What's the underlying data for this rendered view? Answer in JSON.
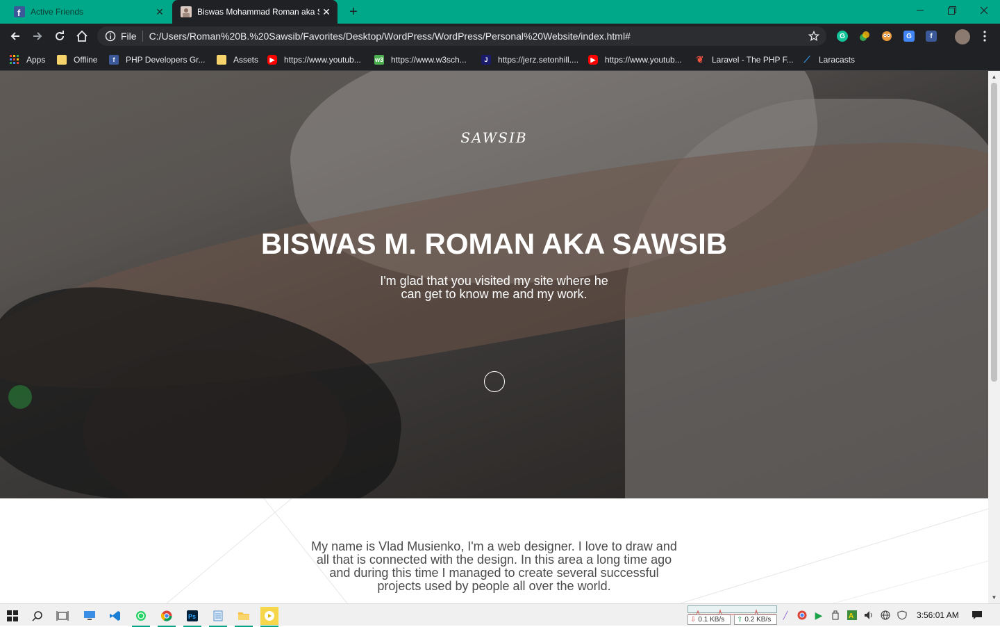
{
  "tabs": [
    {
      "title": "Active Friends",
      "state": "inactive"
    },
    {
      "title": "Biswas Mohammad Roman aka Sawsib",
      "state": "active"
    }
  ],
  "toolbar": {
    "scheme": "File",
    "url": "C:/Users/Roman%20B.%20Sawsib/Favorites/Desktop/WordPress/WordPress/Personal%20Website/index.html#"
  },
  "bookmarks": [
    {
      "label": "Apps",
      "icon": "apps-grid-icon"
    },
    {
      "label": "Offline",
      "icon": "folder-icon"
    },
    {
      "label": "PHP Developers Gr...",
      "icon": "facebook-icon"
    },
    {
      "label": "Assets",
      "icon": "folder-icon"
    },
    {
      "label": "https://www.youtub...",
      "icon": "youtube-icon"
    },
    {
      "label": "https://www.w3sch...",
      "icon": "w3schools-icon"
    },
    {
      "label": "https://jerz.setonhill....",
      "icon": "jerz-icon"
    },
    {
      "label": "https://www.youtub...",
      "icon": "youtube-icon"
    },
    {
      "label": "Laravel - The PHP F...",
      "icon": "laravel-icon"
    },
    {
      "label": "Laracasts",
      "icon": "laracasts-icon"
    }
  ],
  "page": {
    "logo": "SAWSIB",
    "hero_title": "BISWAS M. ROMAN AKA SAWSIB",
    "hero_subtitle": "I'm glad that you visited my site where he can get to know me and my work.",
    "about_text": "My name is Vlad Musienko, I'm a web designer. I love to draw and all that is connected with the design. In this area a long time ago and during this time I managed to create several successful projects used by people all over the world."
  },
  "taskbar": {
    "net_down": "0.1 KB/s",
    "net_up": "0.2 KB/s",
    "clock": "3:56:01 AM"
  },
  "colors": {
    "tabbar": "#00a88a",
    "chrome_dark": "#1f2124",
    "accent_running": "#0aa384"
  }
}
